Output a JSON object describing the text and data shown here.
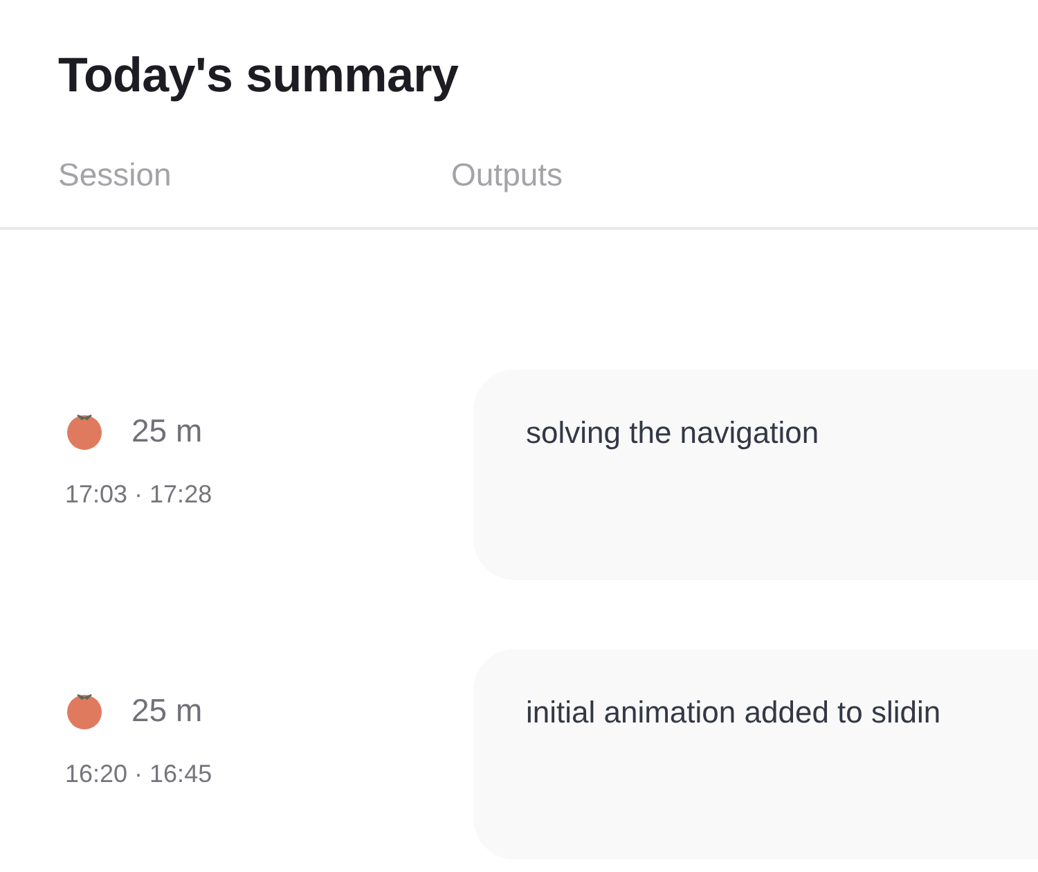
{
  "title": "Today's summary",
  "columns": [
    "Session",
    "Outputs"
  ],
  "sessions": [
    {
      "duration": "25 m",
      "time": "17:03 · 17:28",
      "output": "solving the navigation"
    },
    {
      "duration": "25 m",
      "time": "16:20 · 16:45",
      "output": "initial animation added to slidin"
    }
  ]
}
